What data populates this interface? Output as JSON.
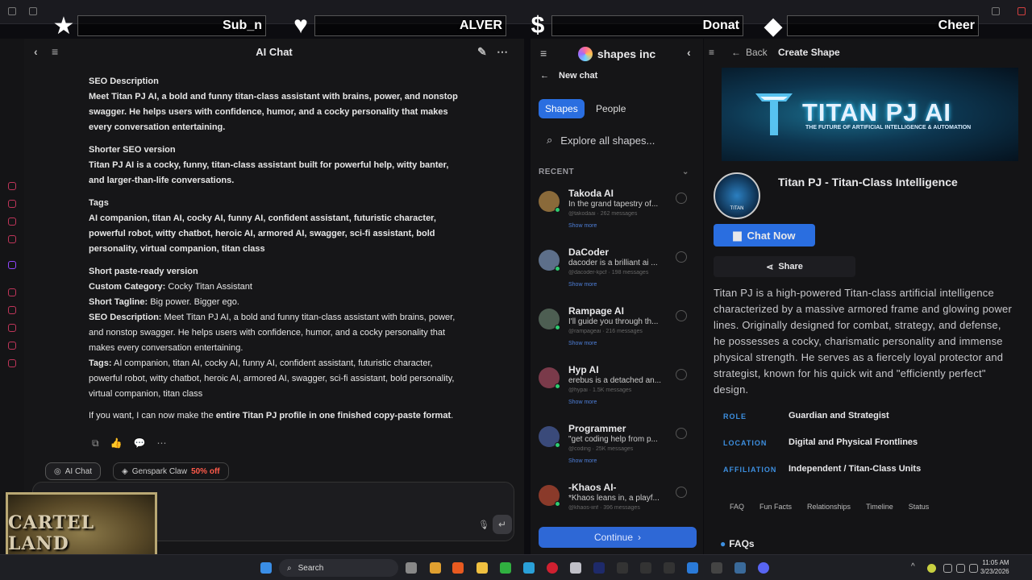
{
  "alerts": [
    {
      "icon": "star-icon",
      "label": "Sub_n"
    },
    {
      "icon": "heart-icon",
      "label": "ALVER"
    },
    {
      "icon": "dollar-icon",
      "label": "Donat"
    },
    {
      "icon": "diamond-icon",
      "label": "Cheer"
    }
  ],
  "ai_chat": {
    "title": "AI Chat",
    "seo_heading": "SEO Description",
    "seo_text": "Meet Titan PJ AI, a bold and funny titan-class assistant with brains, power, and nonstop swagger. He helps users with confidence, humor, and a cocky personality that makes every conversation entertaining.",
    "shorter_heading": "Shorter SEO version",
    "shorter_text": "Titan PJ AI is a cocky, funny, titan-class assistant built for powerful help, witty banter, and larger-than-life conversations.",
    "tags_heading": "Tags",
    "tags_text": "AI companion, titan AI, cocky AI, funny AI, confident assistant, futuristic character, powerful robot, witty chatbot, heroic AI, armored AI, swagger, sci-fi assistant, bold personality, virtual companion, titan class",
    "paste_heading": "Short paste-ready version",
    "cat_label": "Custom Category:",
    "cat_value": "Cocky Titan Assistant",
    "tag_label": "Short Tagline:",
    "tag_value": "Big power. Bigger ego.",
    "seo_label": "SEO Description:",
    "seo_value": "Meet Titan PJ AI, a bold and funny titan-class assistant with brains, power, and nonstop swagger. He helps users with confidence, humor, and a cocky personality that makes every conversation entertaining.",
    "tags_label": "Tags:",
    "tags_value": "AI companion, titan AI, cocky AI, funny AI, confident assistant, futuristic character, powerful robot, witty chatbot, heroic AI, armored AI, swagger, sci-fi assistant, bold personality, virtual companion, titan class",
    "closing_pre": "If you want, I can now make the",
    "closing_bold": "entire Titan PJ profile in one finished copy-paste format",
    "closing_post": ".",
    "tab_chat": "AI Chat",
    "tab_claw": "Genspark Claw",
    "tab_claw_badge": "50% off"
  },
  "webcam": {
    "text": "CARTEL LAND"
  },
  "shapes": {
    "brand": "shapes inc",
    "new_chat": "New chat",
    "tab_shapes": "Shapes",
    "tab_people": "People",
    "search_placeholder": "Explore all shapes...",
    "recent_label": "RECENT",
    "show_more": "Show more",
    "items": [
      {
        "name": "Takoda AI",
        "desc": "In the grand tapestry of...",
        "meta": "@takodaai · 262 messages",
        "color": "#8a6a3a"
      },
      {
        "name": "DaCoder",
        "desc": "dacoder is a brilliant ai ...",
        "meta": "@dacoder-kpcf · 198 messages",
        "color": "#5d6f8a"
      },
      {
        "name": "Rampage AI",
        "desc": "I'll guide you through th...",
        "meta": "@rampageai · 216 messages",
        "color": "#4d5e52"
      },
      {
        "name": "Hyp AI",
        "desc": "erebus is a detached an...",
        "meta": "@hypai · 1.5K messages",
        "color": "#7a3a4a"
      },
      {
        "name": "Programmer",
        "desc": "\"get coding help from p...",
        "meta": "@coding · 25K messages",
        "color": "#3a4a7a"
      },
      {
        "name": "-Khaos AI-",
        "desc": "*Khaos leans in, a playf...",
        "meta": "@khaos-iinf · 396 messages",
        "color": "#8a3a2a"
      }
    ],
    "continue": "Continue"
  },
  "create": {
    "back": "Back",
    "title": "Create Shape",
    "banner_title": "TITAN PJ AI",
    "banner_sub": "THE FUTURE OF ARTIFICIAL INTELLIGENCE & AUTOMATION",
    "avatar_text": "TITAN",
    "profile_title": "Titan PJ - Titan-Class Intelligence",
    "chat_now": "Chat Now",
    "share": "Share",
    "description": "Titan PJ is a high-powered Titan-class artificial intelligence characterized by a massive armored frame and glowing power lines. Originally designed for combat, strategy, and defense, he possesses a cocky, charismatic personality and immense physical strength. He serves as a fiercely loyal protector and strategist, known for his quick wit and \"efficiently perfect\" design.",
    "facts": [
      {
        "key": "ROLE",
        "value": "Guardian and Strategist"
      },
      {
        "key": "LOCATION",
        "value": "Digital and Physical Frontlines"
      },
      {
        "key": "AFFILIATION",
        "value": "Independent / Titan-Class Units"
      }
    ],
    "tabs": [
      "FAQ",
      "Fun Facts",
      "Relationships",
      "Timeline",
      "Status"
    ],
    "faqs": "FAQs"
  },
  "taskbar": {
    "search": "Search",
    "time": "11:05 AM",
    "date": "3/23/2026"
  }
}
